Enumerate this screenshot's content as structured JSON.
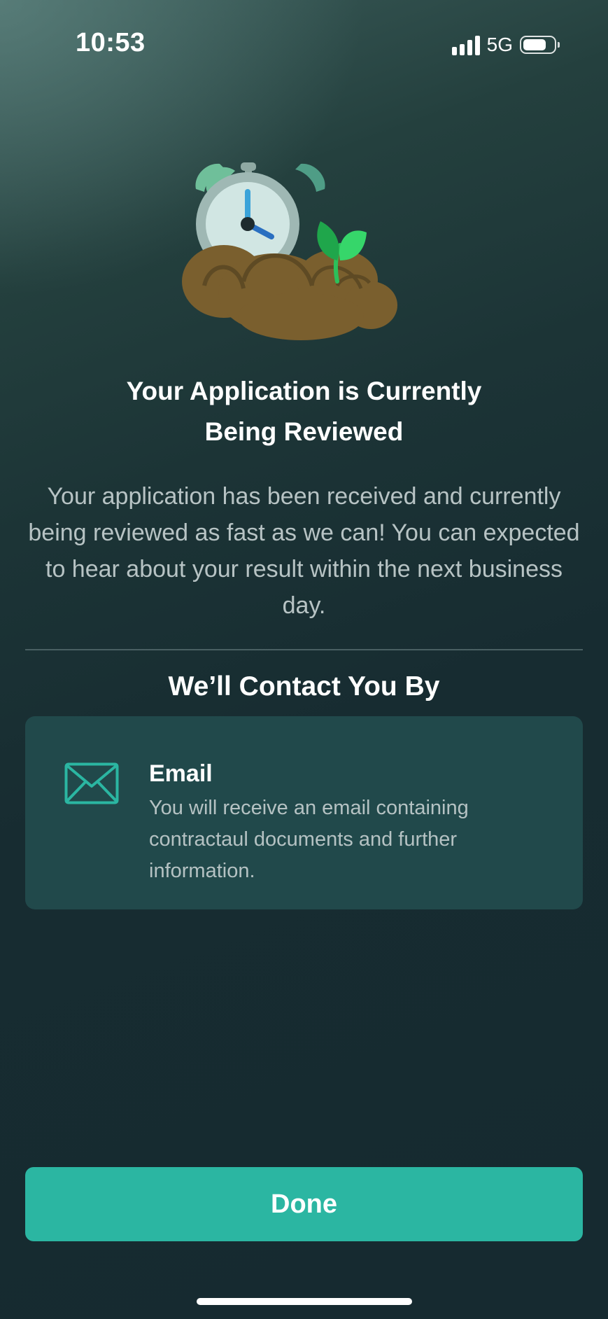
{
  "status_bar": {
    "time": "10:53",
    "network": "5G",
    "signal_icon": "cellular-signal-icon",
    "battery_icon": "battery-icon"
  },
  "illustration": {
    "icon": "alarm-clock-sprout-illustration"
  },
  "main": {
    "title_line1": "Your Application is Currently",
    "title_line2": "Being Reviewed",
    "description": "Your application has been received and currently being reviewed as fast as we can! You can expected to hear about your result within the next business day."
  },
  "contact": {
    "heading": "We’ll Contact You By",
    "method": {
      "icon": "envelope-icon",
      "title": "Email",
      "description": "You will receive an email containing contractaul documents and further information."
    }
  },
  "actions": {
    "done_label": "Done"
  },
  "colors": {
    "accent": "#2bb6a2",
    "card_background": "#21494b",
    "background_dark": "#162a30",
    "muted_text": "#b7c3c4"
  }
}
